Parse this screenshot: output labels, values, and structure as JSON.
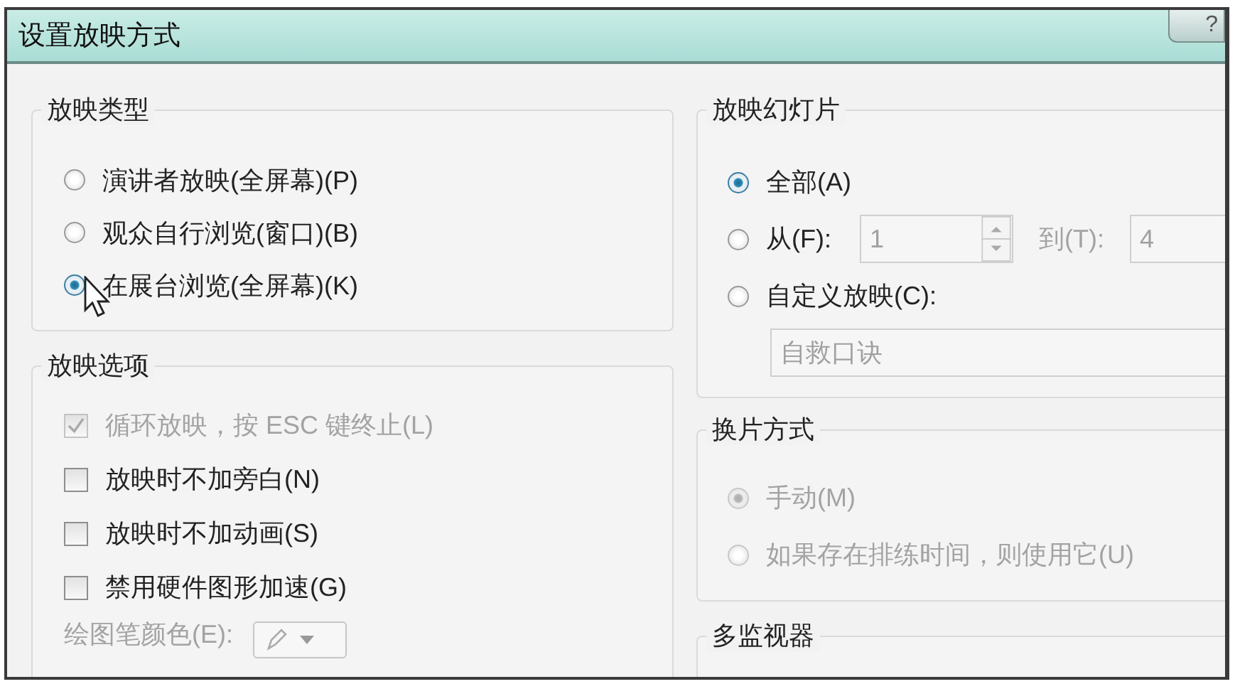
{
  "window": {
    "title": "设置放映方式",
    "help": "?"
  },
  "show_type": {
    "title": "放映类型",
    "options": [
      {
        "label": "演讲者放映(全屏幕)(P)",
        "selected": false
      },
      {
        "label": "观众自行浏览(窗口)(B)",
        "selected": false
      },
      {
        "label": "在展台浏览(全屏幕)(K)",
        "selected": true
      }
    ]
  },
  "show_options": {
    "title": "放映选项",
    "options": [
      {
        "label": "循环放映，按 ESC 键终止(L)",
        "checked": true,
        "disabled": true
      },
      {
        "label": "放映时不加旁白(N)",
        "checked": false,
        "disabled": false
      },
      {
        "label": "放映时不加动画(S)",
        "checked": false,
        "disabled": false
      },
      {
        "label": "禁用硬件图形加速(G)",
        "checked": false,
        "disabled": false
      }
    ],
    "pen_color": {
      "label": "绘图笔颜色(E):"
    }
  },
  "slides": {
    "title": "放映幻灯片",
    "options": [
      {
        "kind": "all",
        "label": "全部(A)",
        "selected": true
      },
      {
        "kind": "range",
        "label": "从(F):",
        "selected": false,
        "from": "1",
        "to_label": "到(T):",
        "to": "4"
      },
      {
        "kind": "custom",
        "label": "自定义放映(C):",
        "selected": false,
        "value": "自救口诀"
      }
    ]
  },
  "advance": {
    "title": "换片方式",
    "options": [
      {
        "label": "手动(M)",
        "selected": true,
        "disabled": true
      },
      {
        "label": "如果存在排练时间，则使用它(U)",
        "selected": false,
        "disabled": true
      }
    ]
  },
  "monitors": {
    "title": "多监视器"
  }
}
